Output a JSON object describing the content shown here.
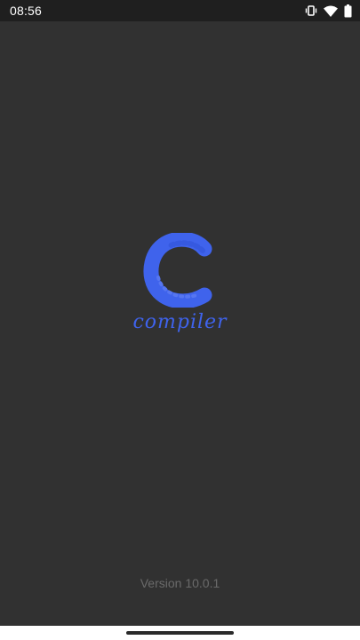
{
  "status_bar": {
    "time": "08:56",
    "icons": [
      "vibrate-icon",
      "wifi-icon",
      "battery-icon"
    ]
  },
  "splash": {
    "logo_letter": "C",
    "logo_word": "compiler",
    "brand_color": "#3f63ec"
  },
  "footer": {
    "version": "Version 10.0.1"
  },
  "colors": {
    "background": "#313131",
    "status_bar": "#1f1f1f",
    "version_text": "#6a6a6a"
  }
}
